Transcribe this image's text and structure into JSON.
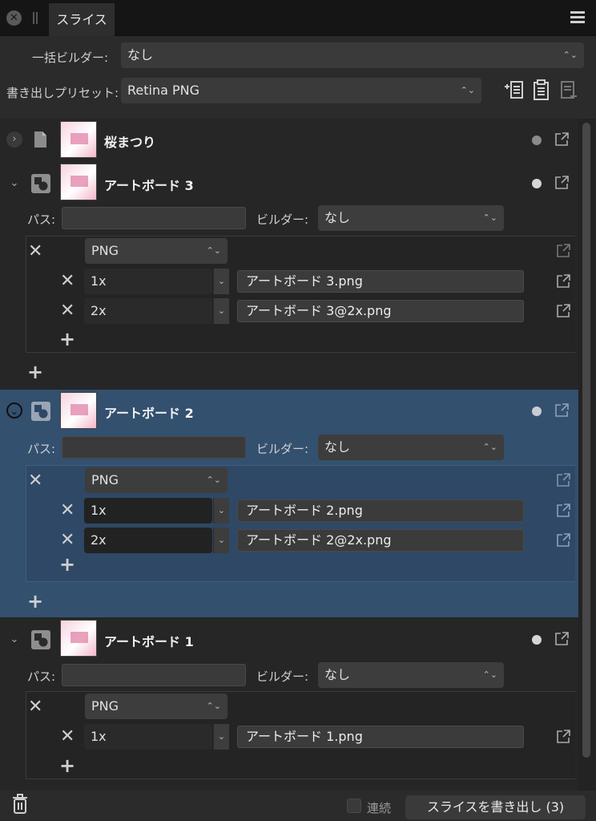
{
  "panel": {
    "tab_label": "スライス"
  },
  "header": {
    "batch_builder_label": "一括ビルダー:",
    "batch_builder_value": "なし",
    "export_preset_label": "書き出しプリセット:",
    "export_preset_value": "Retina PNG"
  },
  "slices": [
    {
      "name": "桜まつり"
    },
    {
      "name": "アートボード 3",
      "path_label": "パス:",
      "builder_label": "ビルダー:",
      "builder_value": "なし",
      "format": "PNG",
      "outputs": [
        {
          "scale": "1x",
          "filename": "アートボード 3.png"
        },
        {
          "scale": "2x",
          "filename": "アートボード 3@2x.png"
        }
      ]
    },
    {
      "name": "アートボード 2",
      "path_label": "パス:",
      "builder_label": "ビルダー:",
      "builder_value": "なし",
      "format": "PNG",
      "outputs": [
        {
          "scale": "1x",
          "filename": "アートボード 2.png"
        },
        {
          "scale": "2x",
          "filename": "アートボード 2@2x.png"
        }
      ]
    },
    {
      "name": "アートボード 1",
      "path_label": "パス:",
      "builder_label": "ビルダー:",
      "builder_value": "なし",
      "format": "PNG",
      "outputs": [
        {
          "scale": "1x",
          "filename": "アートボード 1.png"
        }
      ]
    }
  ],
  "footer": {
    "continuous_label": "連続",
    "export_button": "スライスを書き出し (3)"
  },
  "colors": {
    "selected_row": "#33506f",
    "panel_bg": "#262626"
  }
}
